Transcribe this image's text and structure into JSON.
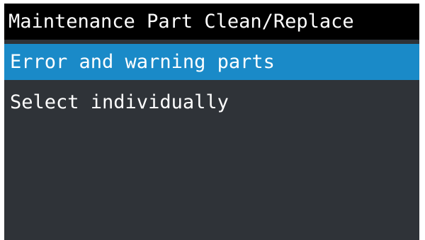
{
  "screen": {
    "title": "Maintenance Part Clean/Replace",
    "menu_items": [
      {
        "label": "Error and warning parts",
        "selected": true
      },
      {
        "label": "Select individually",
        "selected": false
      }
    ]
  },
  "colors": {
    "title_background": "#000000",
    "screen_background": "#2f3338",
    "selection_highlight": "#1a8ac8",
    "text": "#ffffff"
  }
}
